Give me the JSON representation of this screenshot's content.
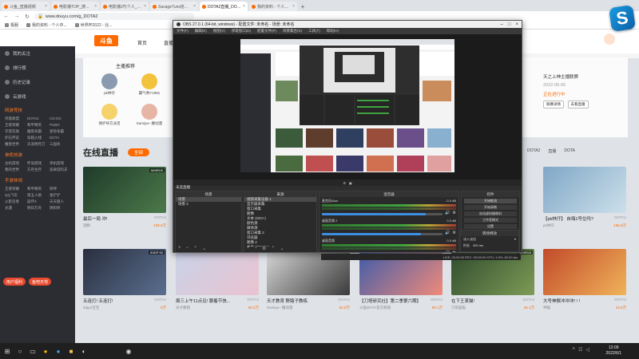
{
  "browser": {
    "tabs": [
      {
        "label": "斗鱼_直播视频",
        "active": false
      },
      {
        "label": "电影播TOP_搜索_神...",
        "active": false
      },
      {
        "label": "电影播2代个人_下出...",
        "active": false
      },
      {
        "label": "SavageTuns抢个人...",
        "active": false
      },
      {
        "label": "DOTA2直播_DOTA2直播...",
        "active": true
      },
      {
        "label": "我的资料 - 个人中心",
        "active": false
      }
    ],
    "address": "www.douyu.com/g_DOTA2",
    "bookmarks": [
      "极服",
      "我的资料 - 个人中...",
      "世界杯2022 - 比..."
    ]
  },
  "site": {
    "logo_text": "斗鱼",
    "nav": [
      "首页",
      "直播"
    ],
    "banner": {
      "title": "主播推荐",
      "anchors": [
        {
          "name": "pk林仔"
        },
        {
          "name": "霸气秀Y1991"
        },
        {
          "name": "保护导方派咨"
        },
        {
          "name": "Sumiya~ 腰动漫"
        }
      ],
      "right_line1": "天之上神主播联赛",
      "right_date": "2022-05-05",
      "right_status": "正在进行中",
      "right_btn1": "联赛详情",
      "right_btn2": "去看直播"
    },
    "sidebar": {
      "top_items": [
        "我的关注",
        "排行榜",
        "历史记录",
        "云游戏"
      ],
      "section1": "网游竞技",
      "grid1": [
        "英雄联盟",
        "DOTA2",
        "CS:GO",
        "王者荣耀",
        "和平精英",
        "PUBG",
        "守望先锋",
        "魔兽争霸",
        "星际争霸",
        "炉石传说",
        "穿越火线",
        "DOTA",
        "魔兽世界",
        "天涯明月刀",
        "三国杀"
      ],
      "section2": "单机热游",
      "grid2": [
        "主机游戏",
        "怀旧游戏",
        "单机游戏",
        "我的世界",
        "方舟生存",
        "逃离塔科夫"
      ],
      "section3": "手游休闲",
      "grid3": [
        "王者荣耀",
        "和平精英",
        "原神",
        "QQ飞车",
        "第五人格",
        "金铲铲",
        "火影忍者",
        "崩坏3",
        "天天狼人",
        "光遇",
        "明日方舟",
        "阴阳师"
      ],
      "btn1": "用户福利",
      "btn2": "鱼吧天地"
    },
    "live": {
      "title": "在线直播",
      "all_label": "全部",
      "cats": [
        "DOTA2",
        "直播",
        "DOTA"
      ]
    },
    "cards": [
      {
        "title": "最后一局 冲!",
        "category": "DOTA2",
        "author": "酒精",
        "heat": "109.6万",
        "desc": "",
        "badge": "MMR5/5"
      },
      {
        "title": "【pk林仔】 自嗨1号位吗?",
        "category": "DOTA2",
        "author": "pk林仔",
        "heat": "156.8万",
        "desc": "",
        "badge": ""
      },
      {
        "title": "五连打! 五连打!",
        "category": "DOTA2",
        "author": "Zippo宝宝",
        "heat": "5万",
        "desc": "",
        "badge": "IDIDP 60"
      },
      {
        "title": "周三上午11点见! 跟着节快...",
        "category": "DOTA2",
        "author": "天才教授",
        "heat": "56.2万",
        "desc": "",
        "badge": ""
      },
      {
        "title": "天才教育 野路子教练",
        "category": "DOTA2",
        "author": "Sumiya~ 腰动漫",
        "heat": "52.8万",
        "desc": "",
        "badge": ""
      },
      {
        "title": "【刀塔研究社】第二季第六期】",
        "category": "DOTA2",
        "author": "斗鱼DOTA官方频道",
        "heat": "69.1万",
        "desc": "",
        "badge": ""
      },
      {
        "title": "在下王某猫!",
        "category": "DOTA2",
        "author": "刀塔猫猫",
        "heat": "46.1万",
        "desc": "",
        "badge": "MMR5/5"
      },
      {
        "title": "大号神猴冲冲冲! ! !",
        "category": "DOTA2",
        "author": "神猴",
        "heat": "44.6万",
        "desc": "",
        "badge": ""
      }
    ]
  },
  "obs": {
    "title": "OBS 27.0.1 (64-bit, windows) - 配置文件: 未命名 - 场景: 未命名",
    "menu": [
      "文件(F)",
      "编辑(E)",
      "视图(V)",
      "停靠窗口(D)",
      "配置文件(P)",
      "场景集合(S)",
      "工具(T)",
      "帮助(H)"
    ],
    "scene_label": "未选直播",
    "docks": {
      "scenes": {
        "title": "场景",
        "items": [
          "场景",
          "场景 2"
        ]
      },
      "sources": {
        "title": "来源",
        "items": [
          "视频采集设备 1",
          "显示器采集",
          "窗口采集",
          "图像",
          "文本 (GDI+)",
          "颜色源",
          "媒体源",
          "窗口采集 2",
          "浏览器",
          "图像 2",
          "文本 (GDI+) 2",
          "游戏采集",
          "音频输入采集",
          "音频输出采集",
          "场景",
          "图像幻灯片",
          "文本 3",
          "颜色源 2"
        ]
      },
      "mixer": {
        "title": "混音器",
        "channels": [
          {
            "name": "麦克风/Aux",
            "db": "-0.0 dB",
            "level": 0.86
          },
          {
            "name": "桌面音频 2",
            "db": "0.0 dB",
            "level": 0.82
          },
          {
            "name": "桌面音频",
            "db": "0.0 dB",
            "level": 0.84
          }
        ]
      },
      "controls": {
        "title": "控件",
        "buttons": [
          "开始推流",
          "开始录制",
          "启动虚拟摄像机",
          "工作室模式",
          "设置",
          "退出"
        ]
      },
      "transitions": {
        "title": "转场特效",
        "fade": "淡入淡出",
        "duration_label": "时长",
        "duration": "300 ms"
      }
    },
    "status": "LIVE: 00:00:00   REC: 00:00:00   CPU: 1.9%, 60.00 fps"
  },
  "taskbar": {
    "time": "12:09",
    "date": "2022/6/1"
  },
  "colors": {
    "accent": "#ff6a00",
    "obs_bg": "#2e2e2e",
    "sidebar": "#2b2d32"
  }
}
